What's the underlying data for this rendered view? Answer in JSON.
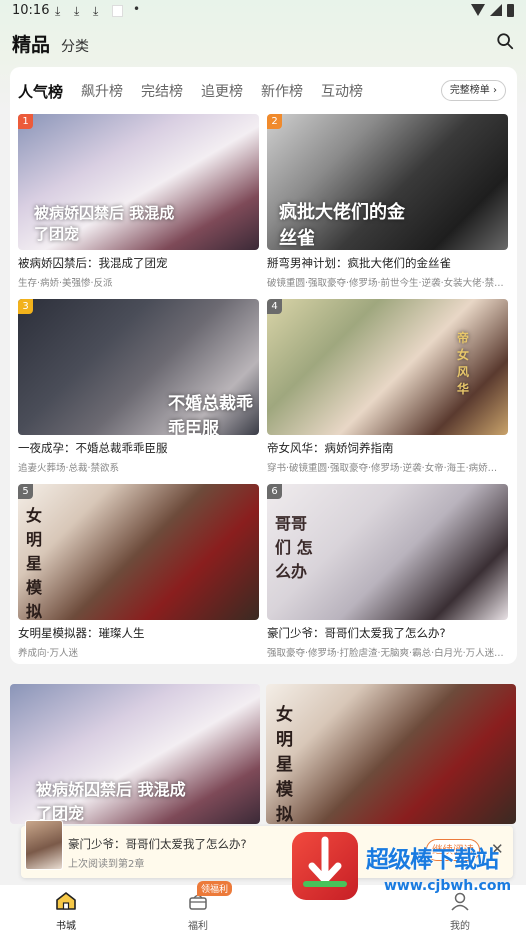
{
  "status_bar": {
    "time": "10:16",
    "dot": "•"
  },
  "top_nav": {
    "active": "精品",
    "other": "分类"
  },
  "rank_tabs": [
    "人气榜",
    "飙升榜",
    "完结榜",
    "追更榜",
    "新作榜",
    "互动榜"
  ],
  "full_rank_label": "完整榜单 ›",
  "ranked_items": [
    {
      "rank": "1",
      "title": "被病娇囚禁后：我混成了团宠",
      "tags": "生存·病娇·美强惨·反派",
      "cover_text": "被病娇囚禁后 我混成了团宠",
      "rank_color": "#ec5b3a"
    },
    {
      "rank": "2",
      "title": "掰弯男神计划：疯批大佬们的金丝雀",
      "tags": "破镜重圆·强取豪夺·修罗场·前世今生·逆袭·女装大佬·禁…",
      "cover_text": "疯批大佬们的金丝雀",
      "rank_color": "#f08a2c"
    },
    {
      "rank": "3",
      "title": "一夜成孕：不婚总裁乖乖臣服",
      "tags": "追妻火葬场·总裁·禁欲系",
      "cover_text": "不婚总裁乖乖臣服",
      "rank_color": "#f2b21b"
    },
    {
      "rank": "4",
      "title": "帝女风华：病娇饲养指南",
      "tags": "穿书·破镜重圆·强取豪夺·修罗场·逆袭·女帝·海王·病娇…",
      "cover_text": "帝女风华",
      "rank_color": "#6b6b6b"
    },
    {
      "rank": "5",
      "title": "女明星模拟器：璀璨人生",
      "tags": "养成向·万人迷",
      "cover_text": "女明星模拟器",
      "rank_color": "#6b6b6b"
    },
    {
      "rank": "6",
      "title": "豪门少爷：哥哥们太爱我了怎么办?",
      "tags": "强取豪夺·修罗场·打脸虐渣·无脑爽·霸总·白月光·万人迷…",
      "cover_text": "哥哥们 怎么办",
      "rank_color": "#6b6b6b"
    }
  ],
  "toast": {
    "title": "豪门少爷：哥哥们太爱我了怎么办?",
    "subtitle": "上次阅读到第2章",
    "continue_label": "继续阅读",
    "close": "✕"
  },
  "bottom_nav": [
    {
      "label": "书城"
    },
    {
      "label": "福利"
    },
    {
      "label": "我的"
    }
  ],
  "welfare_badge": "领福利",
  "watermark": {
    "text": "超级棒下载站",
    "url": "www.cjbwh.com"
  }
}
